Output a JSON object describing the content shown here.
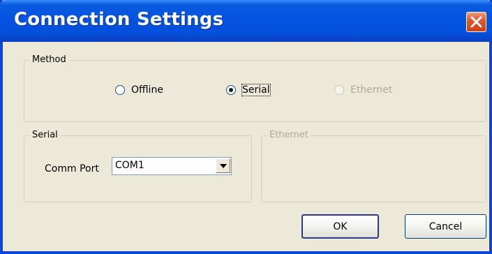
{
  "window": {
    "title": "Connection Settings",
    "close_icon": "close-icon"
  },
  "method_group": {
    "legend": "Method",
    "options": [
      {
        "label": "Offline",
        "selected": false,
        "enabled": true
      },
      {
        "label": "Serial",
        "selected": true,
        "enabled": true
      },
      {
        "label": "Ethernet",
        "selected": false,
        "enabled": false
      }
    ]
  },
  "serial_group": {
    "legend": "Serial",
    "comm_port_label": "Comm Port",
    "comm_port_value": "COM1"
  },
  "ethernet_group": {
    "legend": "Ethernet",
    "enabled": false
  },
  "buttons": {
    "ok_label": "OK",
    "cancel_label": "Cancel"
  },
  "colors": {
    "title_bar": "#0553e0",
    "dialog_bg": "#ece9d8",
    "close_button": "#e0582f",
    "disabled_text": "#aca899"
  }
}
